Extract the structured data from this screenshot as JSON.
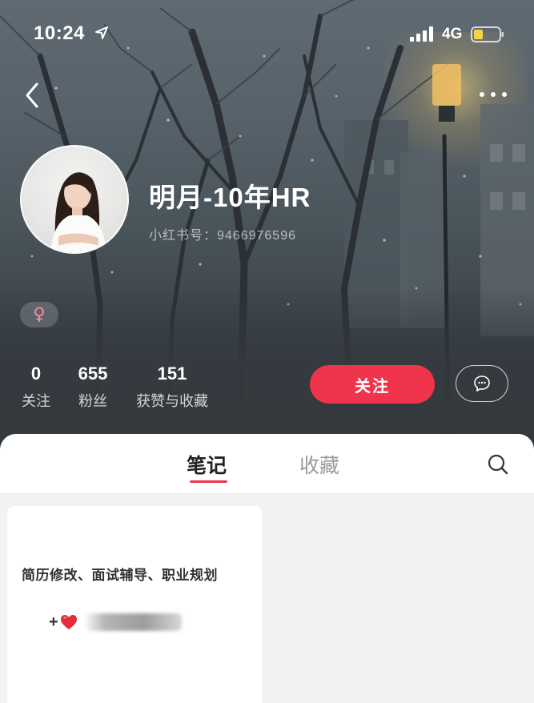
{
  "status_bar": {
    "time": "10:24",
    "network": "4G",
    "icons": [
      "location-arrow-icon",
      "signal-bars-icon",
      "battery-low-icon"
    ]
  },
  "nav": {
    "icons": [
      "back-chevron-icon",
      "more-dots-icon"
    ]
  },
  "profile": {
    "name": "明月-10年HR",
    "id_text": "小红书号：9466976596",
    "gender_icon": "female-symbol-icon"
  },
  "stats": [
    {
      "value": "0",
      "label": "关注"
    },
    {
      "value": "655",
      "label": "粉丝"
    },
    {
      "value": "151",
      "label": "获赞与收藏"
    }
  ],
  "actions": {
    "follow_label": "关注",
    "message_icon": "chat-bubble-icon"
  },
  "tabs": [
    {
      "label": "笔记",
      "active": true
    },
    {
      "label": "收藏",
      "active": false
    }
  ],
  "search_icon": "search-icon",
  "notes": [
    {
      "title": "简历修改、面试辅导、职业规划",
      "prefix": "+",
      "emoji_icon": "red-heart-icon"
    }
  ],
  "colors": {
    "accent": "#f0344b",
    "header_bg": "#34393e",
    "sheet_bg": "#f2f2f2"
  }
}
